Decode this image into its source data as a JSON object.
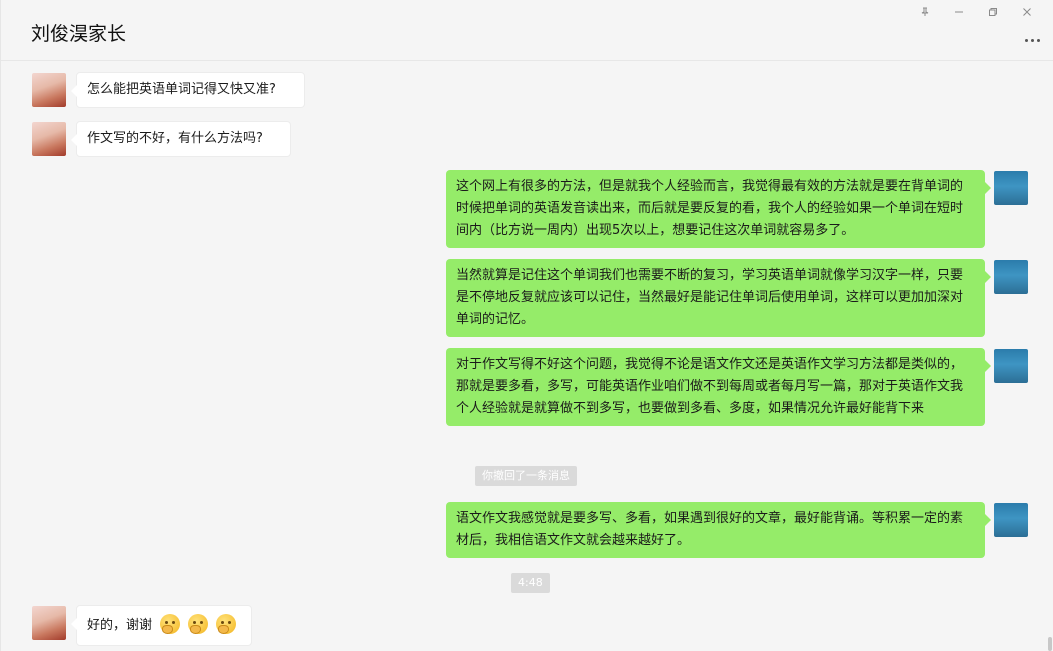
{
  "window": {
    "title": "刘俊淏家长"
  },
  "controls": {
    "pin_icon": "pin-icon",
    "minimize_icon": "minimize-icon",
    "restore_icon": "restore-icon",
    "close_icon": "close-icon",
    "more_icon": "more-icon"
  },
  "messages": {
    "m1": "怎么能把英语单词记得又快又准?",
    "m2": "作文写的不好，有什么方法吗?",
    "m3": "这个网上有很多的方法，但是就我个人经验而言，我觉得最有效的方法就是要在背单词的时候把单词的英语发音读出来，而后就是要反复的看，我个人的经验如果一个单词在短时间内（比方说一周内）出现5次以上，想要记住这次单词就容易多了。",
    "m4": "当然就算是记住这个单词我们也需要不断的复习，学习英语单词就像学习汉字一样，只要是不停地反复就应该可以记住，当然最好是能记住单词后使用单词，这样可以更加加深对单词的记忆。",
    "m5": "对于作文写得不好这个问题，我觉得不论是语文作文还是英语作文学习方法都是类似的，那就是要多看，多写，可能英语作业咱们做不到每周或者每月写一篇，那对于英语作文我个人经验就是就算做不到多写，也要做到多看、多度，如果情况允许最好能背下来",
    "recall_notice": "你撤回了一条消息",
    "m6": "语文作文我感觉就是要多写、多看，如果遇到很好的文章，最好能背诵。等积累一定的素材后，我相信语文作文就会越来越好了。",
    "timestamp": "4:48",
    "m7": "好的，谢谢"
  },
  "colors": {
    "sent_bubble": "#95ec69",
    "received_bubble": "#ffffff",
    "background": "#f5f5f5"
  }
}
